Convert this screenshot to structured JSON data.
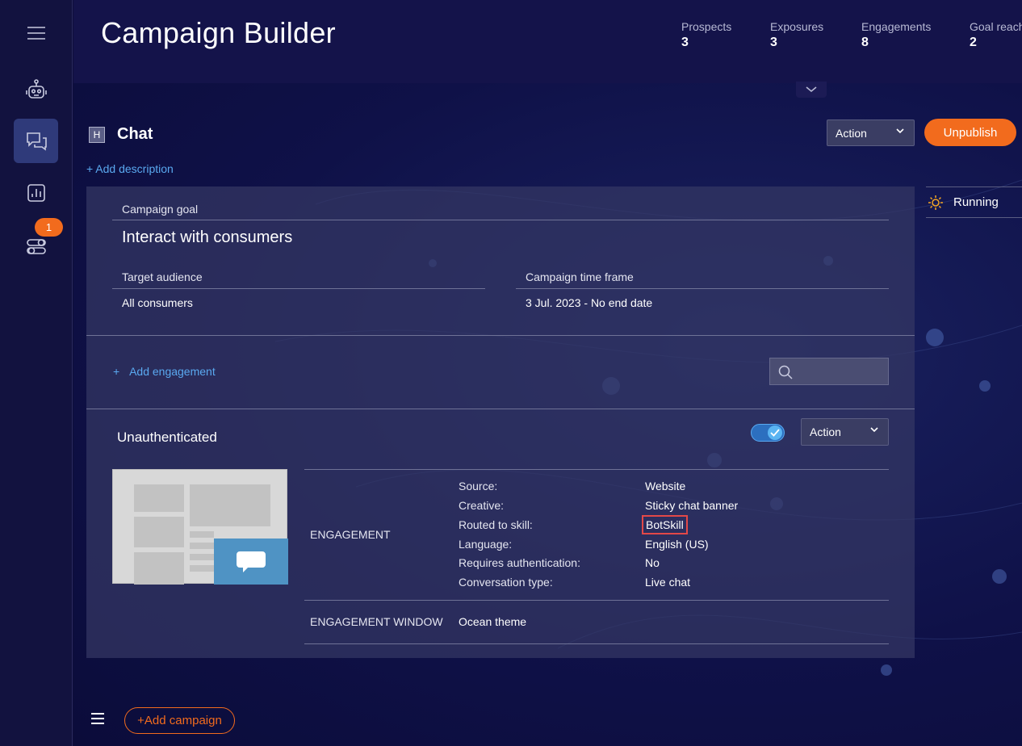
{
  "header": {
    "title": "Campaign Builder",
    "stats": [
      {
        "label": "Prospects",
        "value": "3"
      },
      {
        "label": "Exposures",
        "value": "3"
      },
      {
        "label": "Engagements",
        "value": "8"
      },
      {
        "label": "Goal reach",
        "value": "2"
      }
    ]
  },
  "sidebar": {
    "items": [
      {
        "icon": "menu-icon"
      },
      {
        "icon": "bot-icon"
      },
      {
        "icon": "chat-bubbles-icon",
        "active": true
      },
      {
        "icon": "report-chart-icon"
      },
      {
        "icon": "toggles-icon",
        "badge": "1"
      }
    ]
  },
  "campaign": {
    "h_badge": "H",
    "name": "Chat",
    "add_description": "+ Add description",
    "action_label": "Action",
    "unpublish_label": "Unpublish",
    "status": "Running",
    "goal_label": "Campaign goal",
    "goal_value": "Interact with consumers",
    "audience_label": "Target audience",
    "audience_value": "All consumers",
    "timeframe_label": "Campaign time frame",
    "timeframe_value": "3 Jul. 2023 - No end date",
    "add_engagement": "Add engagement",
    "add_engagement_plus": "+"
  },
  "engagement": {
    "title": "Unauthenticated",
    "action_label": "Action",
    "enabled": true,
    "section_label": "ENGAGEMENT",
    "details": [
      {
        "key": "Source:",
        "value": "Website"
      },
      {
        "key": "Creative:",
        "value": "Sticky chat banner"
      },
      {
        "key": "Routed to skill:",
        "value": "BotSkill"
      },
      {
        "key": "Language:",
        "value": "English (US)"
      },
      {
        "key": "Requires authentication:",
        "value": "No"
      },
      {
        "key": "Conversation type:",
        "value": "Live chat"
      }
    ],
    "window_label": "ENGAGEMENT WINDOW",
    "window_value": "Ocean theme"
  },
  "footer": {
    "add_campaign": "+Add campaign"
  },
  "colors": {
    "accent": "#f26b1d",
    "link": "#5aa9f0",
    "highlight": "#e34848"
  }
}
